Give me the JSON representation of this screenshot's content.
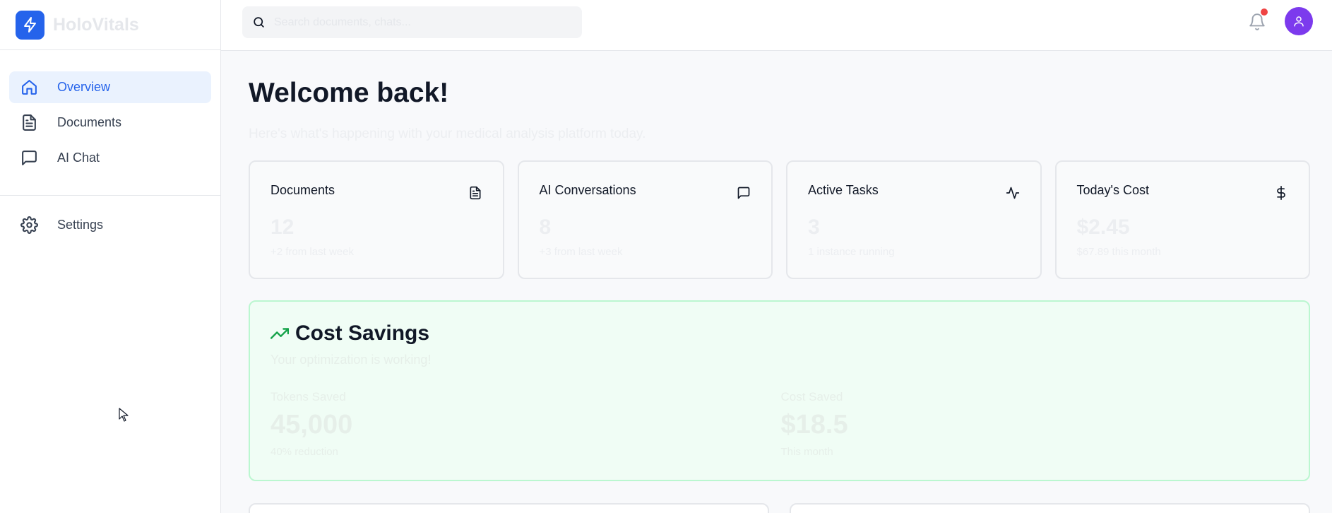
{
  "app": {
    "name": "HoloVitals"
  },
  "sidebar": {
    "items": [
      {
        "label": "Overview",
        "icon": "home-icon",
        "active": true
      },
      {
        "label": "Documents",
        "icon": "document-icon"
      },
      {
        "label": "AI Chat",
        "icon": "chat-icon"
      }
    ],
    "secondary": [
      {
        "label": "Settings",
        "icon": "gear-icon"
      }
    ]
  },
  "header": {
    "search_placeholder": "Search documents, chats...",
    "has_notifications": true
  },
  "main": {
    "title": "Welcome back!",
    "subtitle": "Here's what's happening with your medical analysis platform today.",
    "stats": [
      {
        "title": "Documents",
        "value": "12",
        "note": "+2 from last week",
        "icon": "document-icon"
      },
      {
        "title": "AI Conversations",
        "value": "8",
        "note": "+3 from last week",
        "icon": "chat-icon"
      },
      {
        "title": "Active Tasks",
        "value": "3",
        "note": "1 instance running",
        "icon": "activity-icon"
      },
      {
        "title": "Today's Cost",
        "value": "$2.45",
        "note": "$67.89 this month",
        "icon": "dollar-icon"
      }
    ],
    "savings": {
      "title": "Cost Savings",
      "subtitle": "Your optimization is working!",
      "metrics": [
        {
          "label": "Tokens Saved",
          "value": "45,000",
          "note": "40% reduction"
        },
        {
          "label": "Cost Saved",
          "value": "$18.5",
          "note": "This month"
        }
      ]
    }
  },
  "colors": {
    "accent": "#2563eb",
    "avatar": "#7c3aed",
    "success": "#16a34a",
    "alert": "#ef4444"
  }
}
